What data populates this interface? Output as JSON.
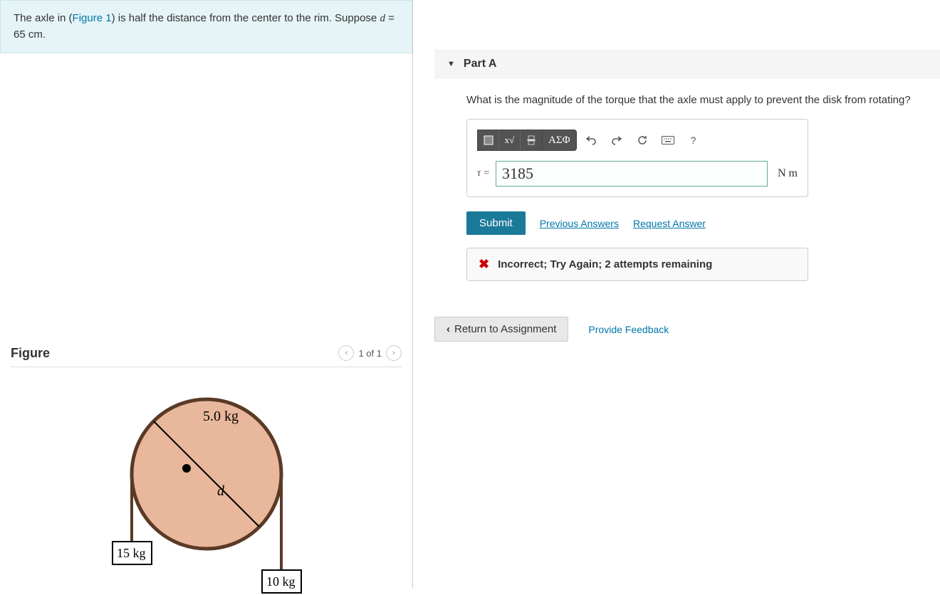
{
  "problem": {
    "prefix": "The axle in (",
    "figure_link": "Figure 1",
    "middle": ") is half the distance from the center to the rim. Suppose ",
    "var": "d",
    "suffix": " = 65 cm."
  },
  "figure": {
    "title": "Figure",
    "pager": "1 of 1",
    "disk_mass": "5.0 kg",
    "diameter_label": "d",
    "left_mass": "15 kg",
    "right_mass": "10 kg"
  },
  "part": {
    "header": "Part A",
    "question": "What is the magnitude of the torque that the axle must apply to prevent the disk from rotating?",
    "tau_label": "τ =",
    "input_value": "3185",
    "unit": "N m",
    "toolbar": {
      "greek": "ΑΣΦ",
      "help": "?"
    },
    "submit": "Submit",
    "prev_answers": "Previous Answers",
    "request_answer": "Request Answer",
    "feedback": "Incorrect; Try Again; 2 attempts remaining"
  },
  "bottom": {
    "return": "Return to Assignment",
    "feedback_link": "Provide Feedback"
  }
}
